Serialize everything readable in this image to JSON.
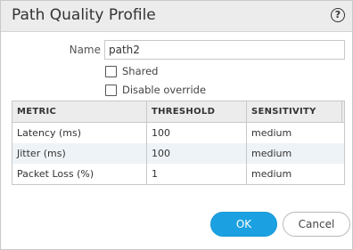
{
  "dialog": {
    "title": "Path Quality Profile",
    "help_icon": "?"
  },
  "form": {
    "name_label": "Name",
    "name_value": "path2",
    "shared_label": "Shared",
    "shared_checked": false,
    "disable_override_label": "Disable override",
    "disable_override_checked": false
  },
  "table": {
    "columns": [
      "METRIC",
      "THRESHOLD",
      "SENSITIVITY"
    ],
    "rows": [
      {
        "metric": "Latency (ms)",
        "threshold": "100",
        "sensitivity": "medium"
      },
      {
        "metric": "Jitter (ms)",
        "threshold": "100",
        "sensitivity": "medium"
      },
      {
        "metric": "Packet Loss (%)",
        "threshold": "1",
        "sensitivity": "medium"
      }
    ]
  },
  "buttons": {
    "ok_label": "OK",
    "cancel_label": "Cancel"
  },
  "colors": {
    "accent": "#1ba1e2",
    "header_bg": "#ececec",
    "alt_row_bg": "#eef3f7"
  }
}
